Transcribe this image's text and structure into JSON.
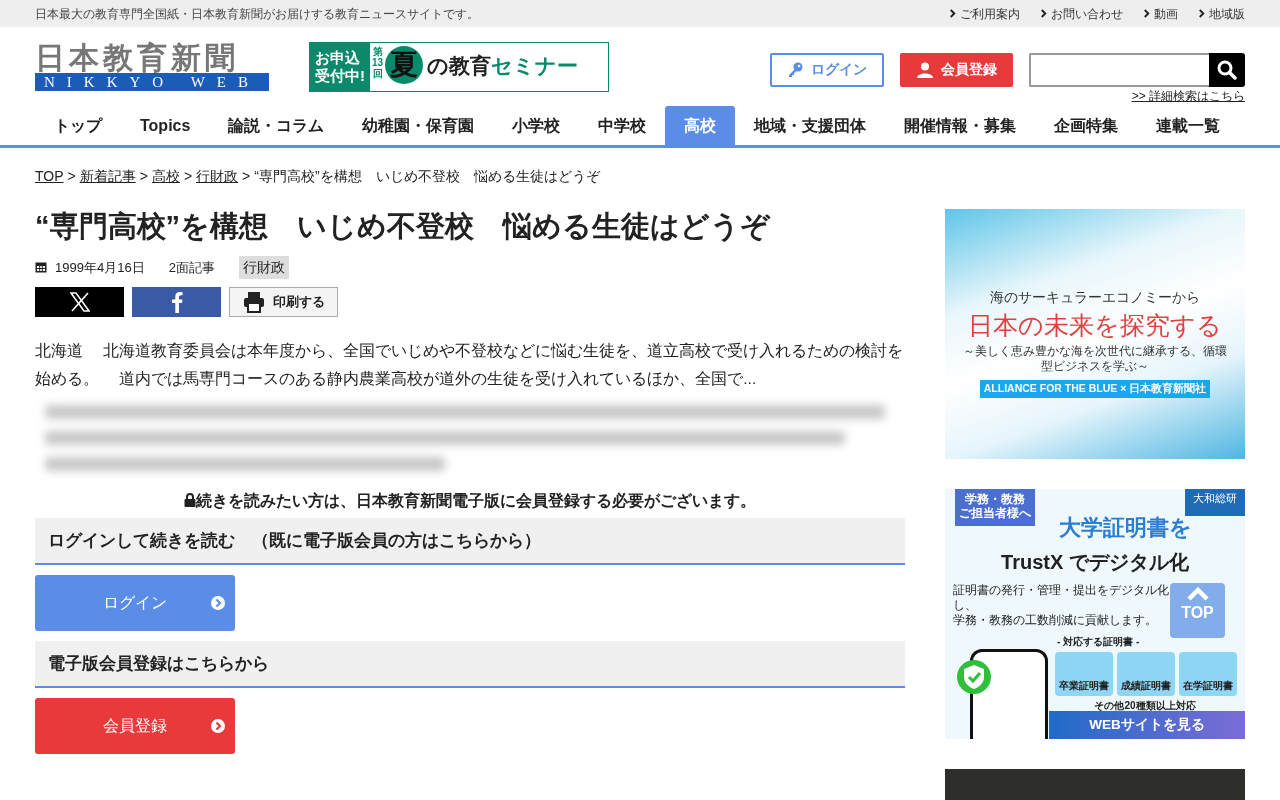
{
  "top_bar": {
    "tagline": "日本最大の教育専門全国紙・日本教育新聞がお届けする教育ニュースサイトです。",
    "links": [
      "ご利用案内",
      "お問い合わせ",
      "動画",
      "地域版"
    ]
  },
  "header": {
    "logo": {
      "title": "日本教育新聞",
      "subtitle": "NIKKYO WEB"
    },
    "seminar_banner": {
      "left": [
        "お申込",
        "受付中!"
      ],
      "issue": "第\n13\n回",
      "big": "夏",
      "title": "の教育",
      "accent": "セミナー"
    },
    "login_button": "ログイン",
    "register_button": "会員登録",
    "advanced_search": ">> 詳細検索はこちら"
  },
  "nav": [
    {
      "label": "トップ",
      "selected": false
    },
    {
      "label": "Topics",
      "selected": false
    },
    {
      "label": "論説・コラム",
      "selected": false
    },
    {
      "label": "幼稚園・保育園",
      "selected": false
    },
    {
      "label": "小学校",
      "selected": false
    },
    {
      "label": "中学校",
      "selected": false
    },
    {
      "label": "高校",
      "selected": true
    },
    {
      "label": "地域・支援団体",
      "selected": false
    },
    {
      "label": "開催情報・募集",
      "selected": false
    },
    {
      "label": "企画特集",
      "selected": false
    },
    {
      "label": "連載一覧",
      "selected": false
    }
  ],
  "breadcrumb": [
    {
      "label": "TOP",
      "link": true
    },
    {
      "separator": ">",
      "label": "新着記事",
      "link": true
    },
    {
      "separator": ">",
      "label": "高校",
      "link": true
    },
    {
      "separator": ">",
      "label": "行財政",
      "link": true
    },
    {
      "separator": ">",
      "label": "“専門高校”を構想　いじめ不登校　悩める生徒はどうぞ",
      "link": false
    }
  ],
  "article": {
    "title": "“専門高校”を構想　いじめ不登校　悩める生徒はどうぞ",
    "date": "1999年4月16日",
    "page": "2面記事",
    "tag": "行財政",
    "print_button": "印刷する",
    "lead": "北海道　 北海道教育委員会は本年度から、全国でいじめや不登校などに悩む生徒を、道立高校で受け入れるための検討を始める。　 道内では馬専門コースのある静内農業高校が道外の生徒を受け入れているほか、全国で...",
    "paywall_notice": "続きを読みたい方は、日本教育新聞電子版に会員登録する必要がございます。",
    "sections": [
      {
        "heading": "ログインして続きを読む　（既に電子版会員の方はこちらから）",
        "button": "ログイン",
        "kind": "login"
      },
      {
        "heading": "電子版会員登録はこちらから",
        "button": "会員登録",
        "kind": "register"
      }
    ]
  },
  "sidebar_ads": [
    {
      "kind": "ocean",
      "lines": [
        "海のサーキュラーエコノミーから",
        "日本の未来を探究する",
        "～美しく恵み豊かな海を次世代に継承する、循環型ビジネスを学ぶ～"
      ],
      "badge": "ALLIANCE FOR THE BLUE × 日本教育新聞社"
    },
    {
      "kind": "certificate",
      "ribbon": [
        "学務・教務",
        "ご担当者様へ"
      ],
      "brand": "大和総研",
      "headline": "大学証明書を",
      "headline2": "TrustX でデジタル化",
      "body": [
        "証明書の発行・管理・提出をデジタル化し、",
        "学務・教務の工数削減に貢献します。"
      ],
      "list_title": "- 対応する証明書 -",
      "items": [
        "卒業証明書",
        "成績証明書",
        "在学証明書"
      ],
      "note": "その他20種類以上対応",
      "cta": "WEBサイトを見る"
    },
    {
      "kind": "photo"
    }
  ],
  "back_to_top": "TOP"
}
